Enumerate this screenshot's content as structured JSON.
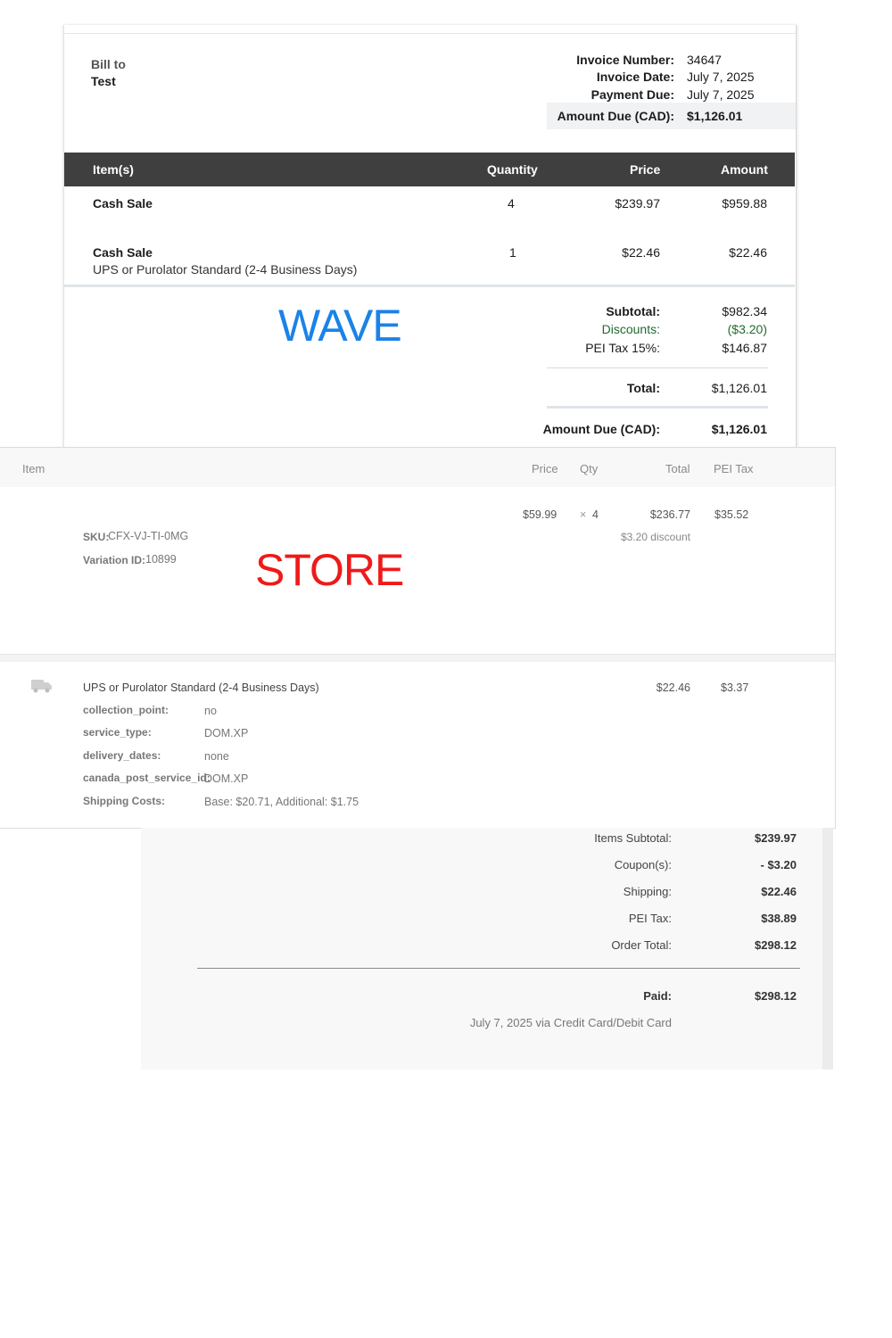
{
  "wave": {
    "watermark": "WAVE",
    "bill_to_label": "Bill to",
    "bill_to_name": "Test",
    "meta": [
      {
        "label": "Invoice Number:",
        "value": "34647"
      },
      {
        "label": "Invoice Date:",
        "value": "July 7, 2025"
      },
      {
        "label": "Payment Due:",
        "value": "July 7, 2025"
      },
      {
        "label": "Amount Due (CAD):",
        "value": "$1,126.01"
      }
    ],
    "columns": {
      "items": "Item(s)",
      "quantity": "Quantity",
      "price": "Price",
      "amount": "Amount"
    },
    "rows": [
      {
        "name": "Cash Sale",
        "desc": "",
        "qty": "4",
        "price": "$239.97",
        "amount": "$959.88"
      },
      {
        "name": "Cash Sale",
        "desc": "UPS or Purolator Standard (2-4 Business Days)",
        "qty": "1",
        "price": "$22.46",
        "amount": "$22.46"
      }
    ],
    "totals": {
      "subtotal_label": "Subtotal:",
      "subtotal": "$982.34",
      "discounts_label": "Discounts:",
      "discounts": "($3.20)",
      "tax_label": "PEI Tax 15%:",
      "tax": "$146.87",
      "total_label": "Total:",
      "total": "$1,126.01",
      "amount_due_label": "Amount Due (CAD):",
      "amount_due": "$1,126.01"
    },
    "colors": {
      "header_bg": "#3f3f3f",
      "discount_green": "#1e6b2e",
      "watermark_blue": "#1b82e8"
    }
  },
  "store": {
    "watermark": "STORE",
    "columns": {
      "item": "Item",
      "price": "Price",
      "qty": "Qty",
      "total": "Total",
      "tax": "PEI Tax"
    },
    "product": {
      "price": "$59.99",
      "qty_x": "×",
      "qty": "4",
      "total": "$236.77",
      "discount_note": "$3.20 discount",
      "tax": "$35.52",
      "sku_label": "SKU:",
      "sku": "CFX-VJ-TI-0MG",
      "variation_label": "Variation ID:",
      "variation": "10899"
    },
    "shipping": {
      "icon": "truck-icon",
      "name": "UPS or Purolator Standard (2-4 Business Days)",
      "total": "$22.46",
      "tax": "$3.37",
      "meta": [
        {
          "key": "collection_point:",
          "value": "no"
        },
        {
          "key": "service_type:",
          "value": "DOM.XP"
        },
        {
          "key": "delivery_dates:",
          "value": "none"
        },
        {
          "key": "canada_post_service_id:",
          "value": "DOM.XP"
        },
        {
          "key": "Shipping Costs:",
          "value": "Base: $20.71, Additional: $1.75"
        }
      ]
    },
    "colors": {
      "watermark_red": "#ee1a1a"
    }
  },
  "totals": {
    "rows": [
      {
        "label": "Items Subtotal:",
        "value": "$239.97"
      },
      {
        "label": "Coupon(s):",
        "value": "- $3.20"
      },
      {
        "label": "Shipping:",
        "value": "$22.46"
      },
      {
        "label": "PEI Tax:",
        "value": "$38.89"
      },
      {
        "label": "Order Total:",
        "value": "$298.12"
      }
    ],
    "paid_label": "Paid:",
    "paid_value": "$298.12",
    "paid_note": "July 7, 2025 via Credit Card/Debit Card"
  }
}
